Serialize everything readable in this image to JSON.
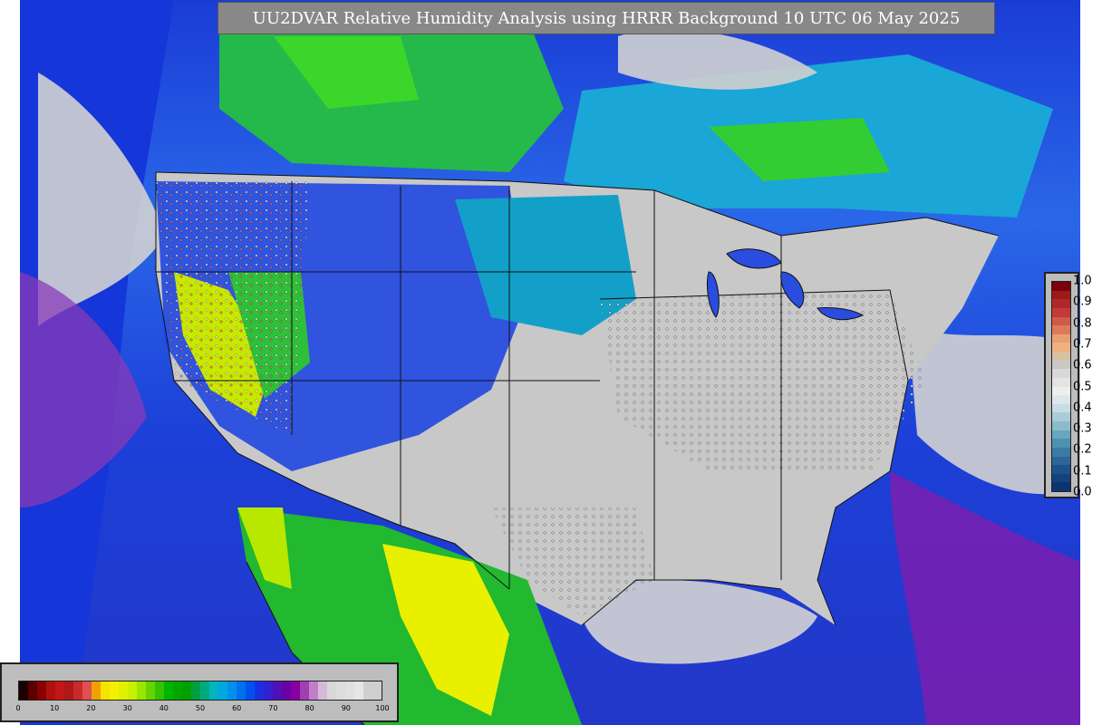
{
  "title": "UU2DVAR Relative Humidity Analysis using HRRR Background 10 UTC 06 May 2025",
  "rh_legend": {
    "ticks": [
      "0",
      "10",
      "20",
      "30",
      "40",
      "50",
      "60",
      "70",
      "80",
      "90",
      "100"
    ],
    "colors": [
      "#1a0000",
      "#5a0000",
      "#8b0000",
      "#b01010",
      "#c41616",
      "#b01818",
      "#cc2a2a",
      "#e05050",
      "#f0a000",
      "#f5e400",
      "#f2f200",
      "#e0f000",
      "#c8f000",
      "#99e600",
      "#66d400",
      "#33c400",
      "#00b400",
      "#00a800",
      "#00a000",
      "#00a040",
      "#00aa80",
      "#00b4c0",
      "#00a8e0",
      "#0090f0",
      "#0070f0",
      "#0050f0",
      "#1a30e0",
      "#3320d0",
      "#5010b8",
      "#6a00a8",
      "#8800a0",
      "#a040b0",
      "#c080c8",
      "#d8b8d8",
      "#d8d8d8",
      "#dcdcdc",
      "#e0e0e0",
      "#e6e6e6",
      "#d0d0d0",
      "#cfcfcf"
    ]
  },
  "qc_legend": {
    "ticks": [
      "1.0",
      "0.9",
      "0.8",
      "0.7",
      "0.6",
      "0.5",
      "0.4",
      "0.3",
      "0.2",
      "0.1",
      "0.0"
    ],
    "colors": [
      "#7a0010",
      "#9e1a1a",
      "#b02828",
      "#c23a3a",
      "#d05a48",
      "#dd7a5a",
      "#e8a070",
      "#f0b080",
      "#d8c0a0",
      "#c8c8c8",
      "#d8d8d8",
      "#e4e4e4",
      "#eeeeee",
      "#dfe6ea",
      "#c8dce4",
      "#a8ccd8",
      "#8abccc",
      "#6aa6be",
      "#4e90b0",
      "#3a7aa4",
      "#2c6698",
      "#1e528a",
      "#14427e",
      "#0c3470"
    ]
  }
}
